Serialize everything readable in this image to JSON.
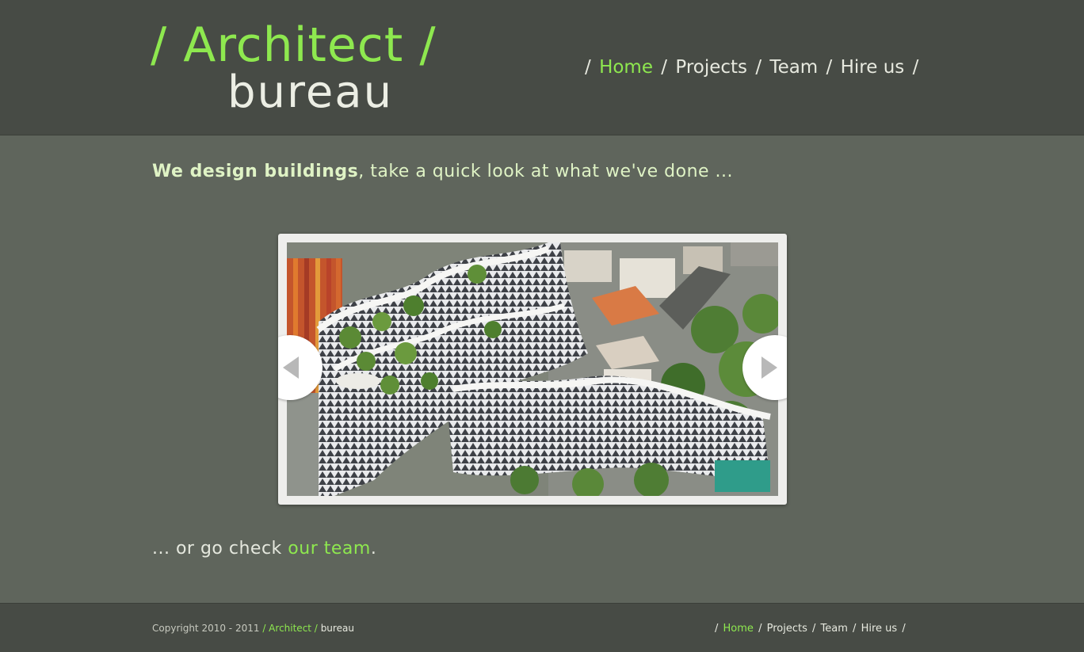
{
  "logo": {
    "top": "/ Architect /",
    "bottom": "bureau"
  },
  "nav": {
    "items": [
      {
        "label": "Home",
        "active": true
      },
      {
        "label": "Projects",
        "active": false
      },
      {
        "label": "Team",
        "active": false
      },
      {
        "label": "Hire us",
        "active": false
      }
    ],
    "separator": "/"
  },
  "tagline": {
    "strong": "We design buildings",
    "rest": ", take a quick look at what we've done ..."
  },
  "slider": {
    "image_alt": "aerial view of modern building with rooftop gardens",
    "prev_icon": "triangle-left-icon",
    "next_icon": "triangle-right-icon"
  },
  "cta": {
    "prefix": "... or go check ",
    "link": "our team",
    "suffix": "."
  },
  "footer": {
    "copyright": "Copyright 2010 - 2011",
    "brand_green": "/ Architect /",
    "brand_white": "bureau",
    "nav": [
      "Home",
      "Projects",
      "Team",
      "Hire us"
    ]
  },
  "colors": {
    "accent": "#8ee84f",
    "header_bg": "#474b45",
    "body_bg": "#5f655c"
  }
}
